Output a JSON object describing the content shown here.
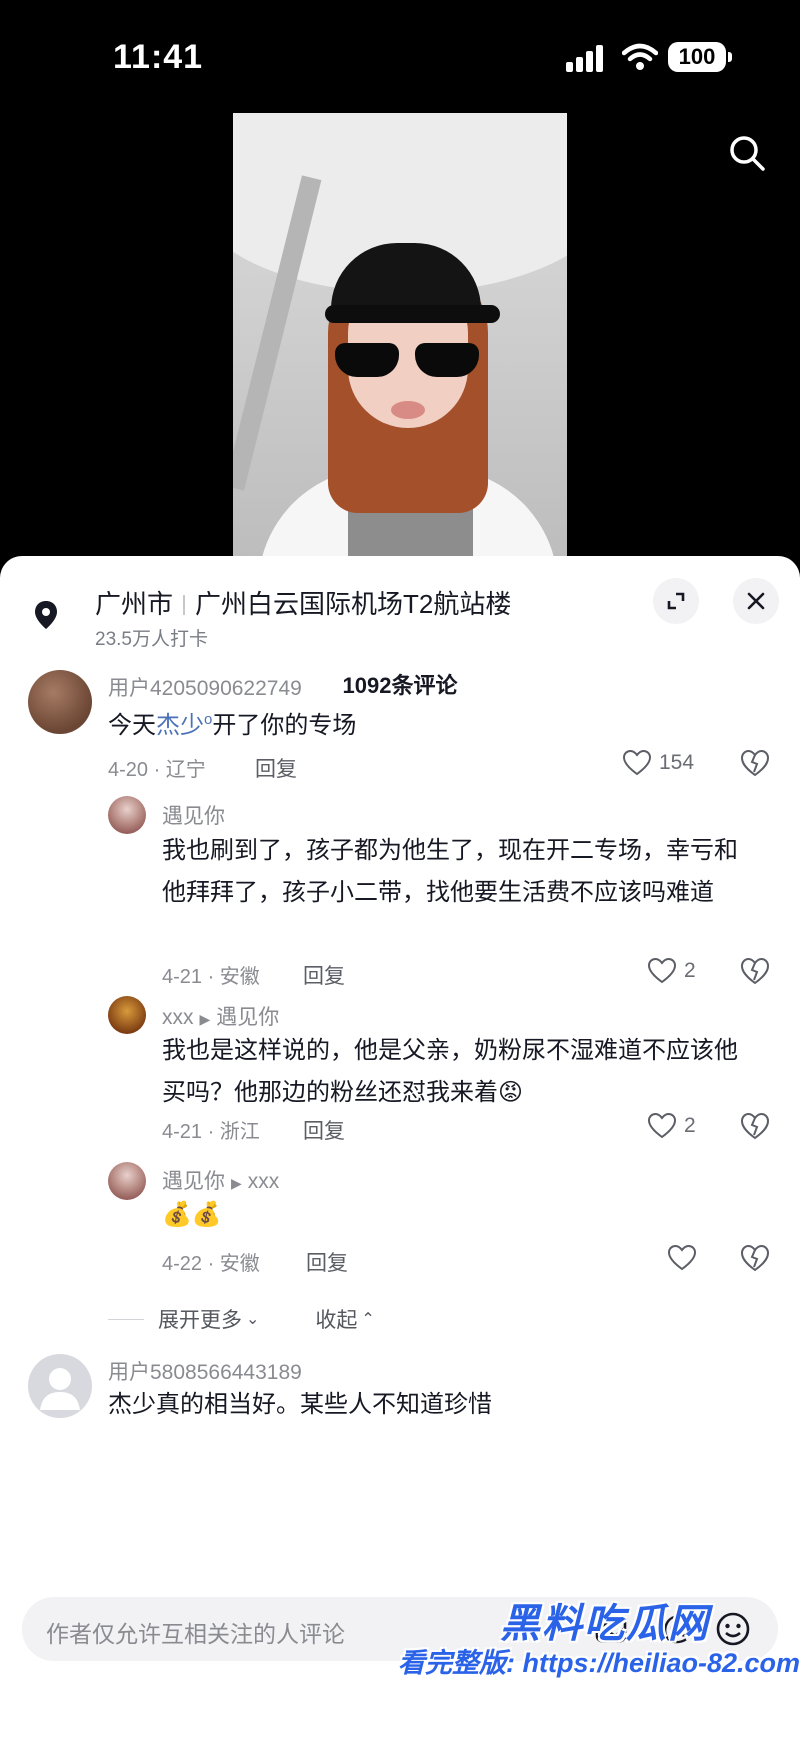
{
  "status": {
    "time": "11:41",
    "battery": "100"
  },
  "location": {
    "city": "广州市",
    "place": "广州白云国际机场T2航站楼",
    "checkins": "23.5万人打卡"
  },
  "comment_count": "1092条评论",
  "comments": [
    {
      "user": "用户4205090622749",
      "text_before": "今天",
      "link": "杰少",
      "text_after": "开了你的专场",
      "meta": "4-20 · 辽宁",
      "reply_label": "回复",
      "likes": "154",
      "replies": [
        {
          "user": "遇见你",
          "text": "我也刷到了，孩子都为他生了，现在开二专场，幸亏和他拜拜了，孩子小二带，找他要生活费不应该吗难道",
          "meta": "4-21 · 安徽",
          "reply_label": "回复",
          "likes": "2"
        },
        {
          "user": "xxx",
          "reply_to": "遇见你",
          "text": "我也是这样说的，他是父亲，奶粉尿不湿难道不应该他买吗？他那边的粉丝还怼我来着😡",
          "meta": "4-21 · 浙江",
          "reply_label": "回复",
          "likes": "2"
        },
        {
          "user": "遇见你",
          "reply_to": "xxx",
          "text": "💰💰",
          "meta": "4-22 · 安徽",
          "reply_label": "回复",
          "likes": ""
        }
      ],
      "expand_label": "展开更多",
      "collapse_label": "收起"
    },
    {
      "user": "用户5808566443189",
      "text": "杰少真的相当好。某些人不知道珍惜"
    }
  ],
  "input": {
    "placeholder": "作者仅允许互相关注的人评论",
    "at": "@"
  },
  "watermark": {
    "line1": "黑料吃瓜网",
    "line2": "看完整版: https://heiliao-82.com"
  },
  "icons": [
    "search-icon",
    "location-pin-icon",
    "expand-icon",
    "close-icon",
    "heart-icon",
    "dislike-icon",
    "at-icon",
    "emoji-icon",
    "image-icon",
    "chevron-down-icon",
    "chevron-up-icon"
  ]
}
